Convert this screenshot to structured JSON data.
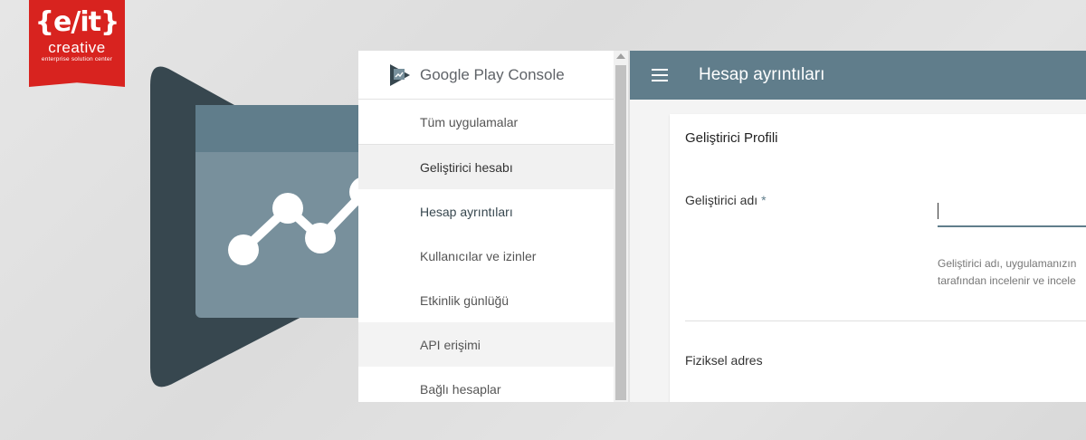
{
  "logo": {
    "mark": "{e/it}",
    "name": "creative",
    "tagline": "enterprise solution center",
    "color": "#d8231f"
  },
  "play_icon": {
    "name": "google-play-console-icon",
    "colors": [
      "#37474f",
      "#78909c",
      "#607d8b"
    ]
  },
  "sidebar": {
    "brand_prefix": "Google Play",
    "brand_suffix": " Console",
    "items": [
      {
        "label": "Tüm uygulamalar"
      },
      {
        "label": "Geliştirici hesabı"
      },
      {
        "label": "Hesap ayrıntıları"
      },
      {
        "label": "Kullanıcılar ve izinler"
      },
      {
        "label": "Etkinlik günlüğü"
      },
      {
        "label": "API erişimi"
      },
      {
        "label": "Bağlı hesaplar"
      }
    ]
  },
  "header": {
    "title": "Hesap ayrıntıları",
    "color": "#607d8b"
  },
  "form": {
    "section_title": "Geliştirici Profili",
    "developer_name_label": "Geliştirici adı",
    "required_marker": "*",
    "developer_name_value": "",
    "hint_line1": "Geliştirici adı, uygulamanızın",
    "hint_line2": "tarafından incelenir ve incele",
    "address_label": "Fiziksel adres"
  }
}
